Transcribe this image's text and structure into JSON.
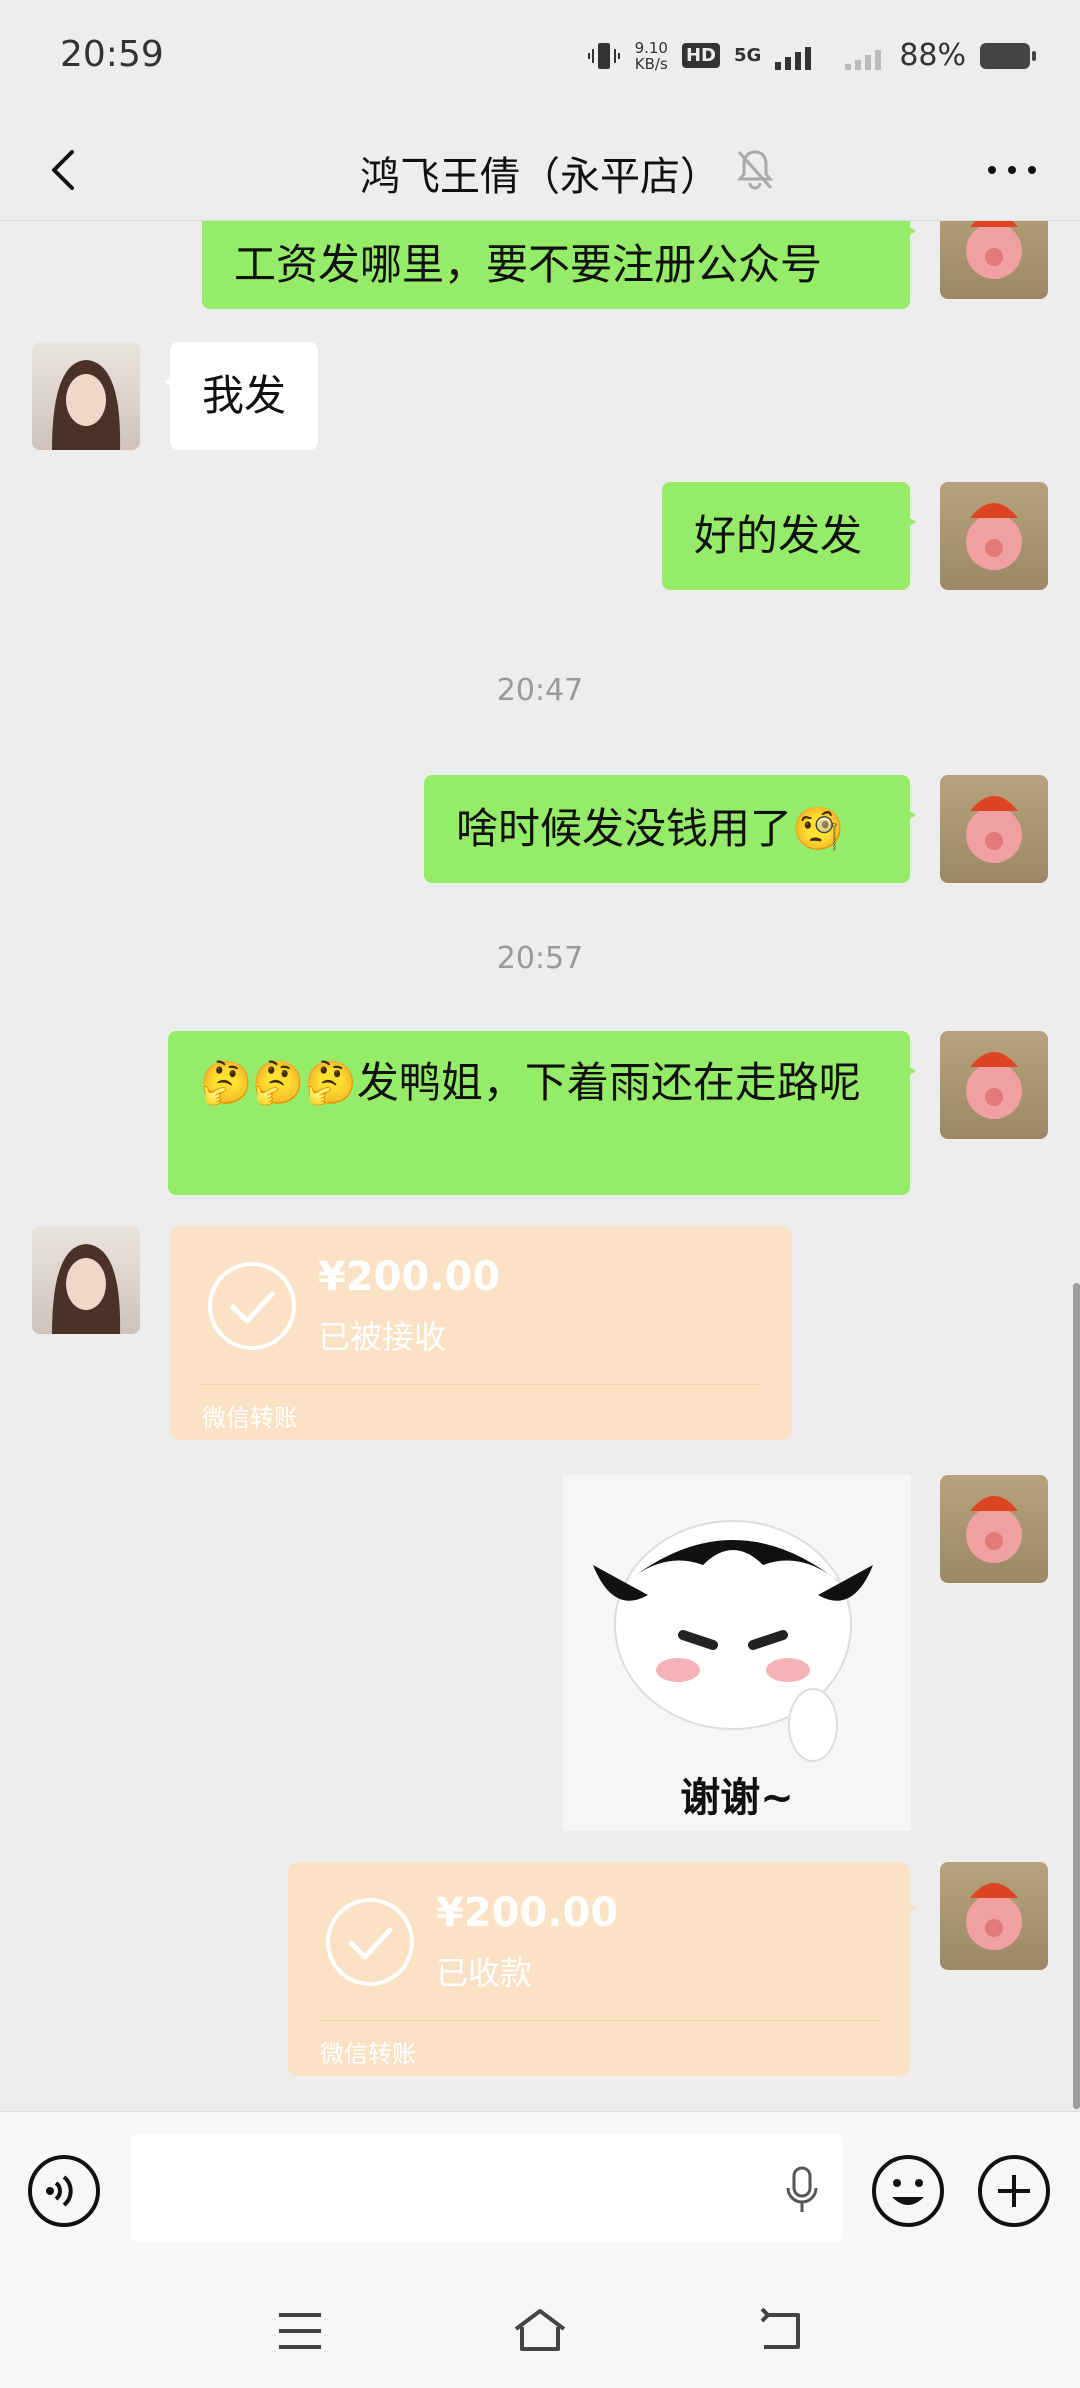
{
  "status_bar": {
    "time": "20:59",
    "speed_value": "9.10",
    "speed_unit": "KB/s",
    "hd": "HD",
    "network": "5G",
    "battery": "88%"
  },
  "nav": {
    "title": "鸿飞王倩（永平店）"
  },
  "messages": {
    "m1": "工资发哪里，要不要注册公众号",
    "m2": "我发",
    "m3": "好的发发",
    "t1": "20:47",
    "m4": "啥时候发没钱用了🧐",
    "t2": "20:57",
    "m5": "🤔🤔🤔发鸭姐，下着雨还在走路呢",
    "transfer1": {
      "amount": "¥200.00",
      "status": "已被接收",
      "label": "微信转账"
    },
    "sticker_text": "谢谢~",
    "transfer2": {
      "amount": "¥200.00",
      "status": "已收款",
      "label": "微信转账"
    }
  },
  "input": {
    "placeholder": ""
  },
  "colors": {
    "background": "#ededed",
    "my_bubble": "#95ec69",
    "their_bubble": "#ffffff",
    "transfer": "#fce2c4"
  }
}
